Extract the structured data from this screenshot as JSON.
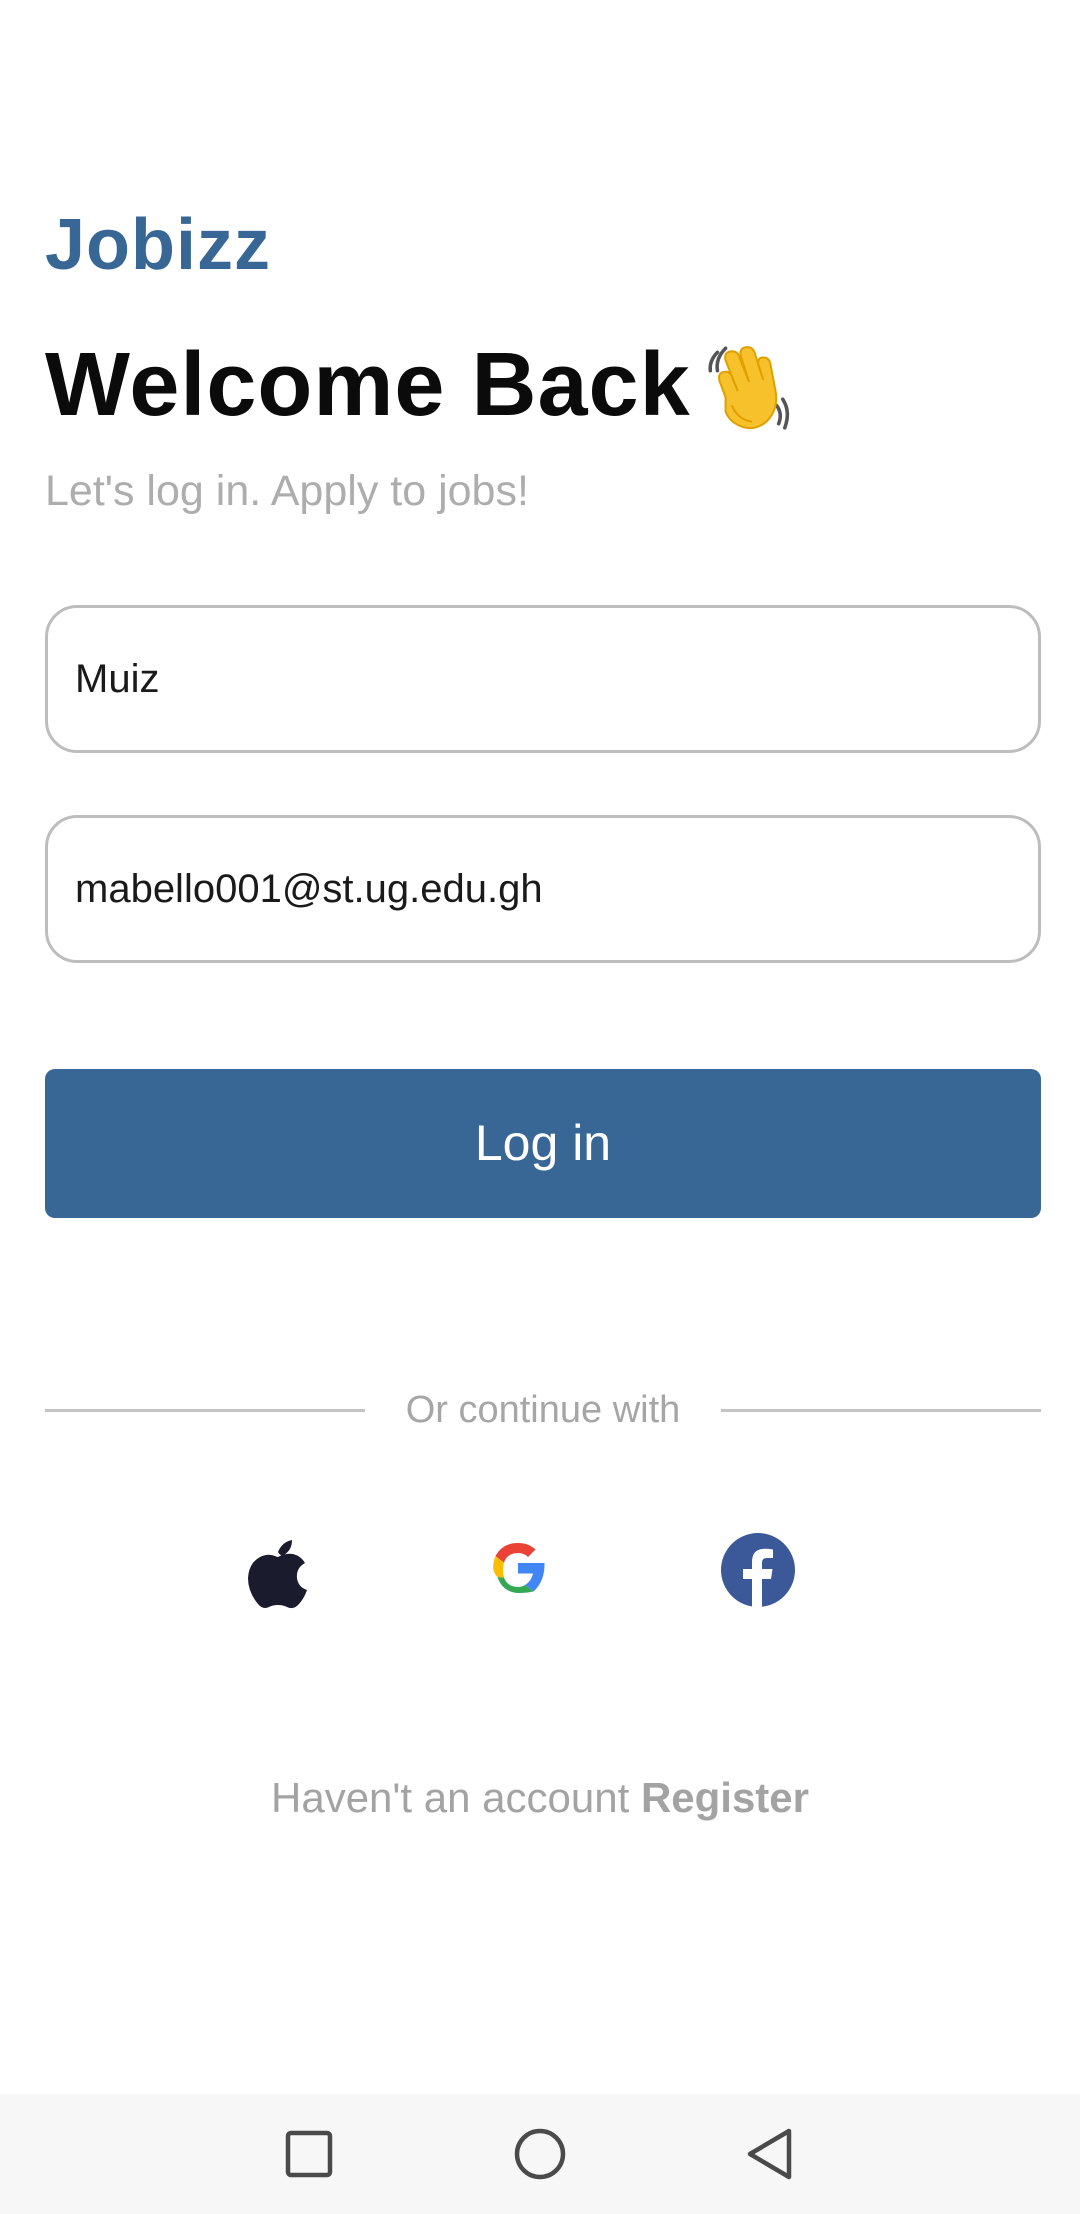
{
  "app": {
    "brand": "Jobizz",
    "title": "Welcome Back",
    "subtitle": "Let's log in. Apply to jobs!"
  },
  "form": {
    "name_value": "Muiz",
    "email_value": "mabello001@st.ug.edu.gh",
    "login_label": "Log in"
  },
  "divider": {
    "text": "Or continue with"
  },
  "social": [
    {
      "icon": "apple-icon"
    },
    {
      "icon": "google-icon"
    },
    {
      "icon": "facebook-icon"
    }
  ],
  "footer": {
    "prompt": "Haven't an account",
    "register_label": "Register"
  },
  "colors": {
    "brand": "#386795",
    "muted_text": "#adadad",
    "title_text": "#0b0b0b",
    "border": "#bdbdbd",
    "facebook_blue": "#3b5998"
  },
  "navigation_bar": {
    "buttons": [
      "recent-apps-icon",
      "home-icon",
      "back-icon"
    ]
  }
}
